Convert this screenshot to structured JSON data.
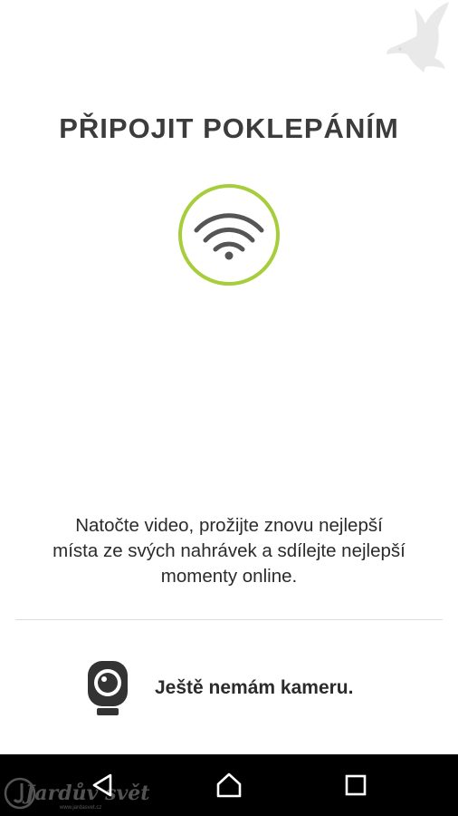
{
  "header": {
    "brand_icon": "bird-logo-icon",
    "title": "PŘIPOJIT POKLEPÁNÍM"
  },
  "hero": {
    "icon": "wifi-icon",
    "ring_color": "#a6cd3a"
  },
  "description": {
    "line1": "Natočte video, prožijte znovu nejlepší",
    "line2": "místa ze svých nahrávek a sdílejte nejlepší",
    "line3": "momenty online."
  },
  "no_camera": {
    "icon": "webcam-icon",
    "label": "Ještě nemám kameru."
  },
  "nav_bar": {
    "back_icon": "back-triangle-icon",
    "home_icon": "home-icon",
    "recents_icon": "recents-square-icon"
  },
  "watermark": {
    "text": "Jardův svět",
    "subtext": "www.jardasvet.cz"
  }
}
